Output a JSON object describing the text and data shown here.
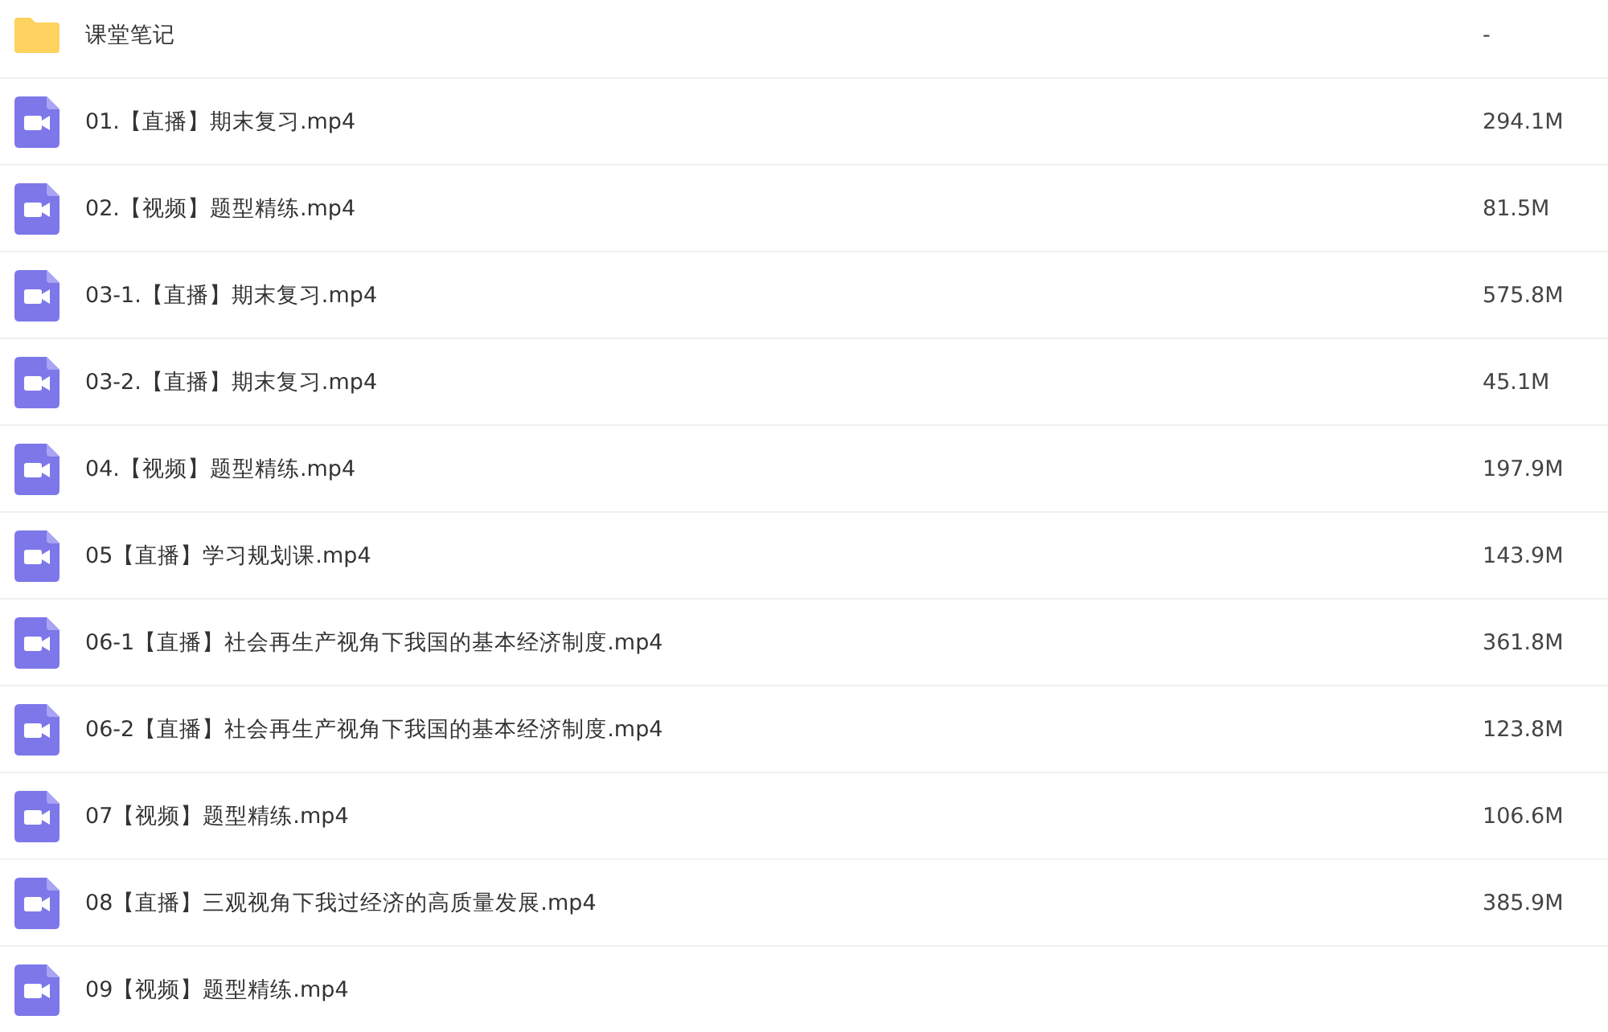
{
  "files": [
    {
      "kind": "folder",
      "name": "课堂笔记",
      "size": "-"
    },
    {
      "kind": "video",
      "name": "01.【直播】期末复习.mp4",
      "size": "294.1M"
    },
    {
      "kind": "video",
      "name": "02.【视频】题型精练.mp4",
      "size": "81.5M"
    },
    {
      "kind": "video",
      "name": "03-1.【直播】期末复习.mp4",
      "size": "575.8M"
    },
    {
      "kind": "video",
      "name": "03-2.【直播】期末复习.mp4",
      "size": "45.1M"
    },
    {
      "kind": "video",
      "name": "04.【视频】题型精练.mp4",
      "size": "197.9M"
    },
    {
      "kind": "video",
      "name": "05【直播】学习规划课.mp4",
      "size": "143.9M"
    },
    {
      "kind": "video",
      "name": "06-1【直播】社会再生产视角下我国的基本经济制度.mp4",
      "size": "361.8M"
    },
    {
      "kind": "video",
      "name": "06-2【直播】社会再生产视角下我国的基本经济制度.mp4",
      "size": "123.8M"
    },
    {
      "kind": "video",
      "name": "07【视频】题型精练.mp4",
      "size": "106.6M"
    },
    {
      "kind": "video",
      "name": "08【直播】三观视角下我过经济的高质量发展.mp4",
      "size": "385.9M"
    },
    {
      "kind": "video",
      "name": "09【视频】题型精练.mp4"
    }
  ]
}
